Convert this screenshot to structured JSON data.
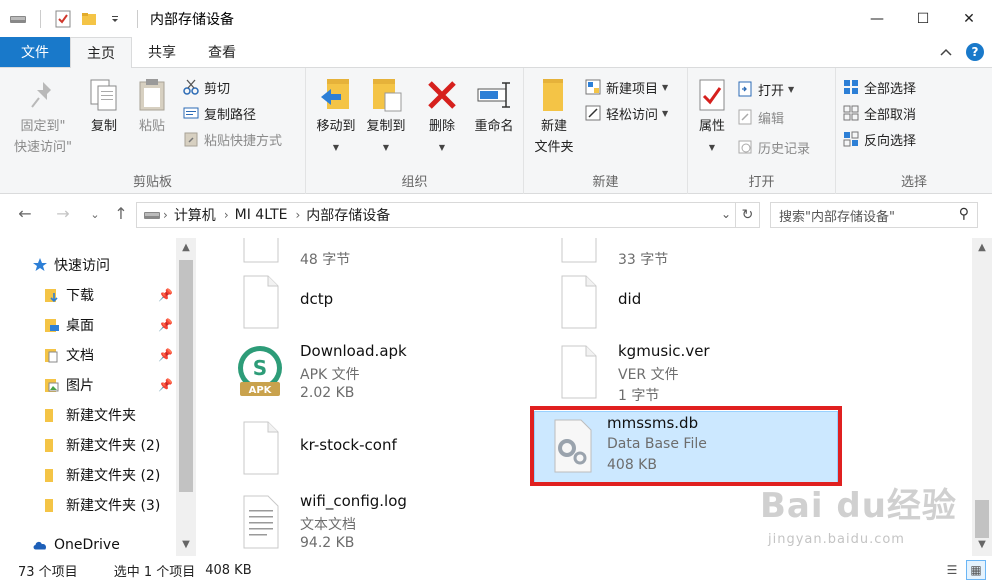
{
  "window": {
    "title": "内部存储设备",
    "minimize": "—",
    "maximize": "☐",
    "close": "✕"
  },
  "tabs": [
    {
      "label": "文件"
    },
    {
      "label": "主页"
    },
    {
      "label": "共享"
    },
    {
      "label": "查看"
    }
  ],
  "ribbon": {
    "clipboard": {
      "label": "剪贴板",
      "pin_quick_line1": "固定到\"",
      "pin_quick_line2": "快速访问\"",
      "copy": "复制",
      "paste": "粘贴",
      "cut": "剪切",
      "copy_path": "复制路径",
      "paste_shortcut": "粘贴快捷方式"
    },
    "organize": {
      "label": "组织",
      "move_to": "移动到",
      "copy_to": "复制到",
      "delete": "删除",
      "rename": "重命名"
    },
    "new": {
      "label": "新建",
      "new_folder_line1": "新建",
      "new_folder_line2": "文件夹",
      "new_item": "新建项目",
      "easy_access": "轻松访问"
    },
    "open": {
      "label": "打开",
      "properties": "属性",
      "open": "打开",
      "edit": "编辑",
      "history": "历史记录"
    },
    "select": {
      "label": "选择",
      "select_all": "全部选择",
      "select_none": "全部取消",
      "invert": "反向选择"
    }
  },
  "address": {
    "crumbs": [
      "计算机",
      "MI 4LTE",
      "内部存储设备"
    ],
    "search_placeholder": "搜索\"内部存储设备\""
  },
  "nav": {
    "quick_access": "快速访问",
    "items": [
      {
        "label": "下载"
      },
      {
        "label": "桌面"
      },
      {
        "label": "文档"
      },
      {
        "label": "图片"
      },
      {
        "label": "新建文件夹"
      },
      {
        "label": "新建文件夹 (2)"
      },
      {
        "label": "新建文件夹 (2)"
      },
      {
        "label": "新建文件夹 (3)"
      }
    ],
    "onedrive": "OneDrive"
  },
  "files": [
    {
      "name": "",
      "type": "",
      "size": "48 字节"
    },
    {
      "name": "",
      "type": "",
      "size": "33 字节"
    },
    {
      "name": "dctp",
      "type": "",
      "size": ""
    },
    {
      "name": "did",
      "type": "",
      "size": ""
    },
    {
      "name": "Download.apk",
      "type": "APK 文件",
      "size": "2.02 KB"
    },
    {
      "name": "kgmusic.ver",
      "type": "VER 文件",
      "size": "1 字节"
    },
    {
      "name": "kr-stock-conf",
      "type": "",
      "size": ""
    },
    {
      "name": "mmssms.db",
      "type": "Data Base File",
      "size": "408 KB"
    },
    {
      "name": "wifi_config.log",
      "type": "文本文档",
      "size": "94.2 KB"
    }
  ],
  "apk_badge": "APK",
  "status": {
    "count": "73 个项目",
    "selected": "选中 1 个项目",
    "selected_size": "408 KB"
  },
  "watermark": {
    "logo": "Bai du经验",
    "sub": "jingyan.baidu.com"
  },
  "colors": {
    "accent": "#1979ca",
    "selection": "#cce8ff",
    "highlight_border": "#e02020"
  }
}
